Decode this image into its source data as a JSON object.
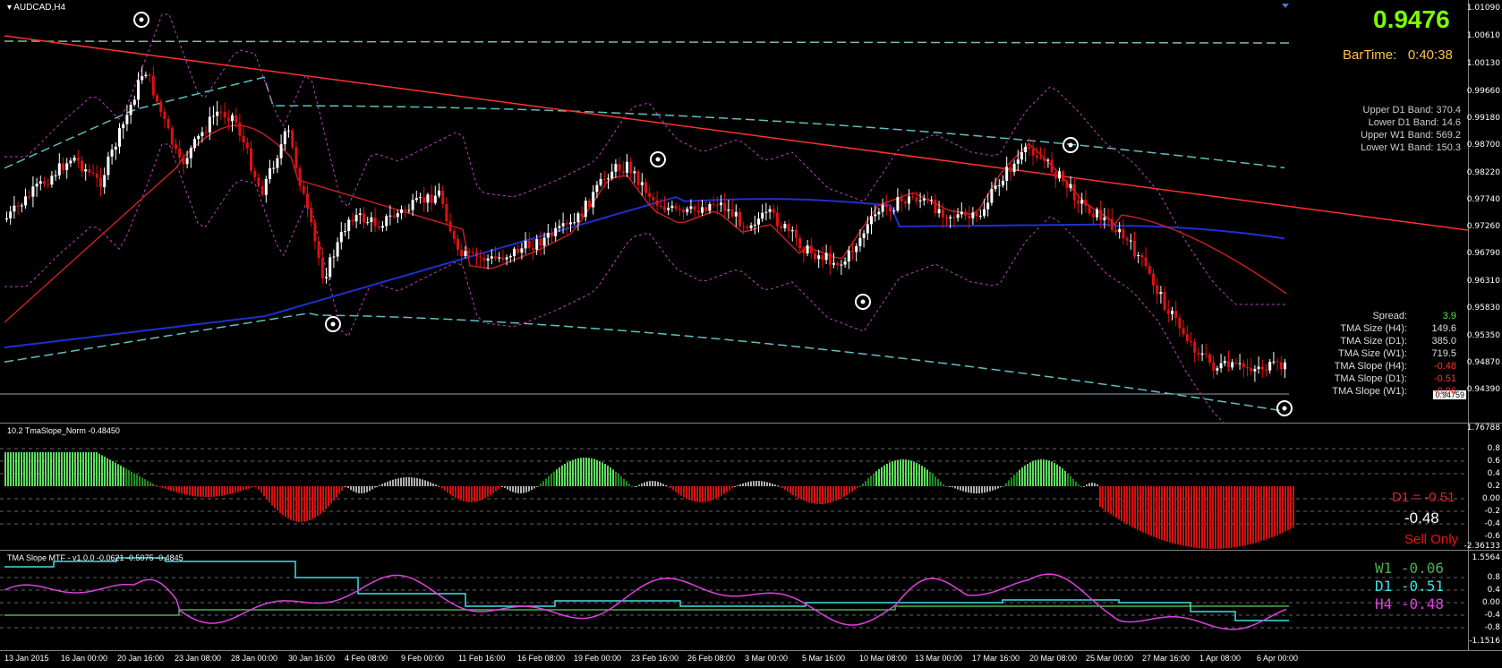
{
  "main": {
    "title": "AUDCAD,H4",
    "price_axis": [
      "1.01090",
      "1.00610",
      "1.00130",
      "0.99660",
      "0.99180",
      "0.98700",
      "0.98220",
      "0.97740",
      "0.97260",
      "0.96790",
      "0.96310",
      "0.95830",
      "0.95350",
      "0.94870",
      "0.94390"
    ],
    "current_price_tag": "0.94759",
    "big_price": "0.9476",
    "bartime_label": "BarTime:",
    "bartime_value": "0:40:38",
    "bands": [
      "Upper D1 Band: 370.4",
      "Lower D1 Band: 14.6",
      "Upper W1 Band: 569.2",
      "Lower W1 Band: 150.3"
    ],
    "stats": [
      {
        "k": "Spread:",
        "v": "3.9",
        "color": "#5fdc5f"
      },
      {
        "k": "TMA Size (H4):",
        "v": "149.6",
        "color": "#dddddd"
      },
      {
        "k": "TMA Size (D1):",
        "v": "385.0",
        "color": "#dddddd"
      },
      {
        "k": "TMA Size (W1):",
        "v": "719.5",
        "color": "#dddddd"
      },
      {
        "k": "TMA Slope (H4):",
        "v": "-0.48",
        "color": "#ff3030"
      },
      {
        "k": "TMA Slope (D1):",
        "v": "-0.51",
        "color": "#ff3030"
      },
      {
        "k": "TMA Slope (W1):",
        "v": "-0.06",
        "color": "#ff3030"
      }
    ]
  },
  "ind1": {
    "title": "10.2 TmaSlope_Norm -0.48450",
    "axis": [
      "1.76788",
      "0.8",
      "0.6",
      "0.4",
      "0.2",
      "0.00",
      "-0.2",
      "-0.4",
      "-0.6",
      "-2.36133"
    ],
    "d1_label": "D1 = -0.51",
    "h4_value": "-0.48",
    "sell_label": "Sell Only"
  },
  "ind2": {
    "title": "TMA Slope MTF - v1.0.0 -0.0621 -0.5075 -0.4845",
    "axis": [
      "1.5564",
      "0.8",
      "0.4",
      "0.00",
      "-0.4",
      "-0.8",
      "-1.1516"
    ],
    "w1_label": "W1 -0.06",
    "d1_label": "D1 -0.51",
    "h4_label": "H4 -0.48"
  },
  "time_axis": [
    "13 Jan 2015",
    "16 Jan 00:00",
    "20 Jan 16:00",
    "23 Jan 08:00",
    "28 Jan 00:00",
    "30 Jan 16:00",
    "4 Feb 08:00",
    "9 Feb 00:00",
    "11 Feb 16:00",
    "16 Feb 08:00",
    "19 Feb 00:00",
    "23 Feb 16:00",
    "26 Feb 08:00",
    "3 Mar 00:00",
    "5 Mar 16:00",
    "10 Mar 08:00",
    "13 Mar 00:00",
    "17 Mar 16:00",
    "20 Mar 08:00",
    "25 Mar 00:00",
    "27 Mar 16:00",
    "1 Apr 08:00",
    "6 Apr 00:00"
  ],
  "colors": {
    "bull": "#ffffff",
    "bear": "#e01010",
    "trend": "#ff3030",
    "tma": "#1f2fd0",
    "band_inner": "#c040c0",
    "band_outer": "#60c0c0",
    "hist_up": "#1e8c1e",
    "hist_up_bright": "#5fdc5f",
    "hist_down": "#d01010",
    "hist_neutral": "#b0b0b0",
    "w1": "#4caf50",
    "d1": "#40e0e0",
    "h4": "#e040e0"
  },
  "icons": [
    "triangle-down-icon",
    "swing-marker-icon"
  ]
}
